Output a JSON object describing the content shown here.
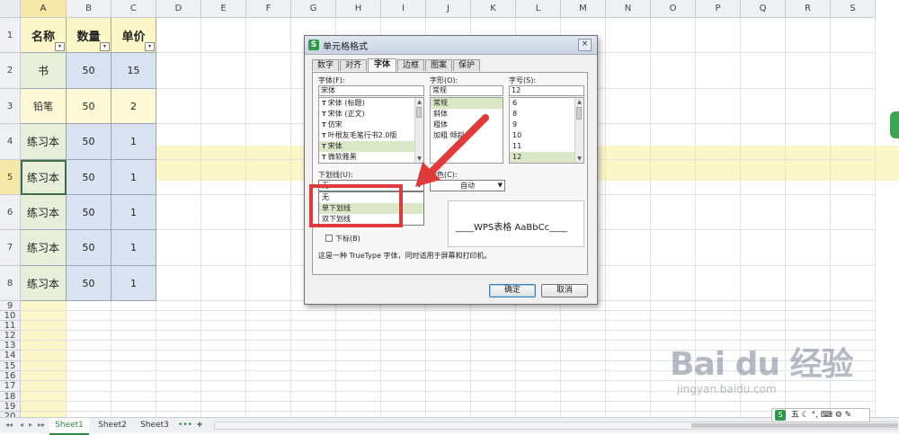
{
  "spreadsheet": {
    "columns": [
      "A",
      "B",
      "C",
      "D",
      "E",
      "F",
      "G",
      "H",
      "I",
      "J",
      "K",
      "L",
      "M",
      "N",
      "O",
      "P",
      "Q",
      "R",
      "S"
    ],
    "rows": [
      "1",
      "2",
      "3",
      "4",
      "5",
      "6",
      "7",
      "8",
      "9",
      "10",
      "11",
      "12",
      "13",
      "14",
      "15",
      "16",
      "17",
      "18",
      "19",
      "20"
    ],
    "header_row": [
      "名称",
      "数量",
      "单价"
    ],
    "data": [
      [
        "书",
        "50",
        "15"
      ],
      [
        "铅笔",
        "50",
        "2"
      ],
      [
        "练习本",
        "50",
        "1"
      ],
      [
        "练习本",
        "50",
        "1"
      ],
      [
        "练习本",
        "50",
        "1"
      ],
      [
        "练习本",
        "50",
        "1"
      ],
      [
        "练习本",
        "50",
        "1"
      ]
    ],
    "filter_glyph": "▾"
  },
  "dialog": {
    "title": "单元格格式",
    "close_glyph": "×",
    "tabs": [
      "数字",
      "对齐",
      "字体",
      "边框",
      "图案",
      "保护"
    ],
    "font_label": "字体(F):",
    "font_value": "宋体",
    "font_list": [
      "宋体 (标题)",
      "宋体 (正文)",
      "仿宋",
      "叶根友毛笔行书2.0版",
      "宋体",
      "微软雅黑"
    ],
    "style_label": "字形(O):",
    "style_value": "常规",
    "style_list": [
      "常规",
      "斜体",
      "粗体",
      "加粗 倾斜"
    ],
    "size_label": "字号(S):",
    "size_value": "12",
    "size_list": [
      "6",
      "8",
      "9",
      "10",
      "11",
      "12"
    ],
    "underline_label": "下划线(U):",
    "underline_value": "无",
    "underline_options": [
      "无",
      "单下划线",
      "双下划线"
    ],
    "color_label": "颜色(C):",
    "color_value": "自动",
    "preview_label": "预览",
    "preview_text": "____WPS表格  AaBbCc____",
    "subscript_label": "下标(B)",
    "info_text": "这是一种 TrueType 字体，同时适用于屏幕和打印机。",
    "ok_label": "确定",
    "cancel_label": "取消"
  },
  "sheets": {
    "tabs": [
      "Sheet1",
      "Sheet2",
      "Sheet3"
    ],
    "more_glyph": "•••",
    "add_glyph": "+"
  },
  "watermark": {
    "brand": "Bai du 经验",
    "url": "jingyan.baidu.com"
  },
  "ime": {
    "logo": "S",
    "text": "五 ☾ °, ⌨ ⚙ ✎"
  },
  "colors": {
    "accent_green": "#2e8b3b",
    "annotation_red": "#e03a3a",
    "row_highlight": "#fbf7c9"
  }
}
